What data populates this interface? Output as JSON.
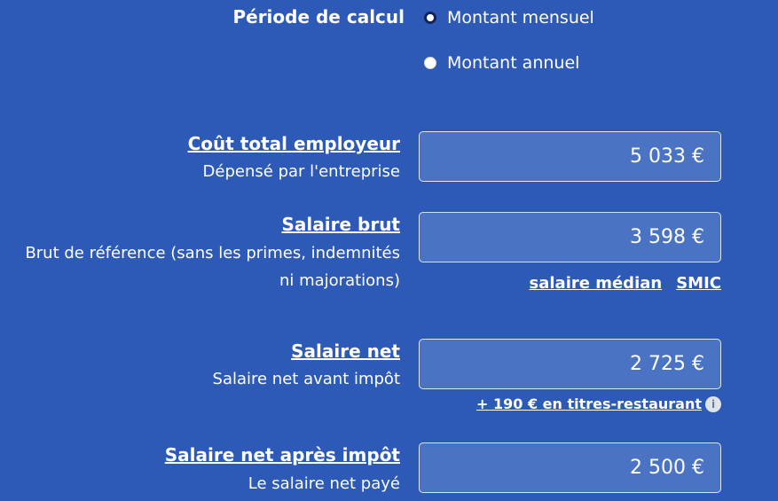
{
  "period": {
    "label": "Période de calcul",
    "options": [
      {
        "label": "Montant mensuel",
        "selected": true
      },
      {
        "label": "Montant annuel",
        "selected": false
      }
    ]
  },
  "fields": {
    "cout_total": {
      "title": "Coût total employeur",
      "subtitle": "Dépensé par l'entreprise",
      "value": "5 033 €"
    },
    "salaire_brut": {
      "title": "Salaire brut",
      "subtitle": "Brut de référence (sans les primes, indemnités ni majorations)",
      "value": "3 598 €"
    },
    "salaire_net": {
      "title": "Salaire net",
      "subtitle": "Salaire net avant impôt",
      "value": "2 725 €"
    },
    "salaire_net_apres_impot": {
      "title": "Salaire net après impôt",
      "subtitle": "Le salaire net payé",
      "value": "2 500 €"
    }
  },
  "brut_links": {
    "median": "salaire médian",
    "smic": "SMIC"
  },
  "titres_restaurant": {
    "text": "+ 190 € en titres-restaurant",
    "icon": "info-icon"
  },
  "colors": {
    "background": "#2e5ab7",
    "input_bg": "#4a73c4",
    "radio_checked": "#12245a"
  }
}
